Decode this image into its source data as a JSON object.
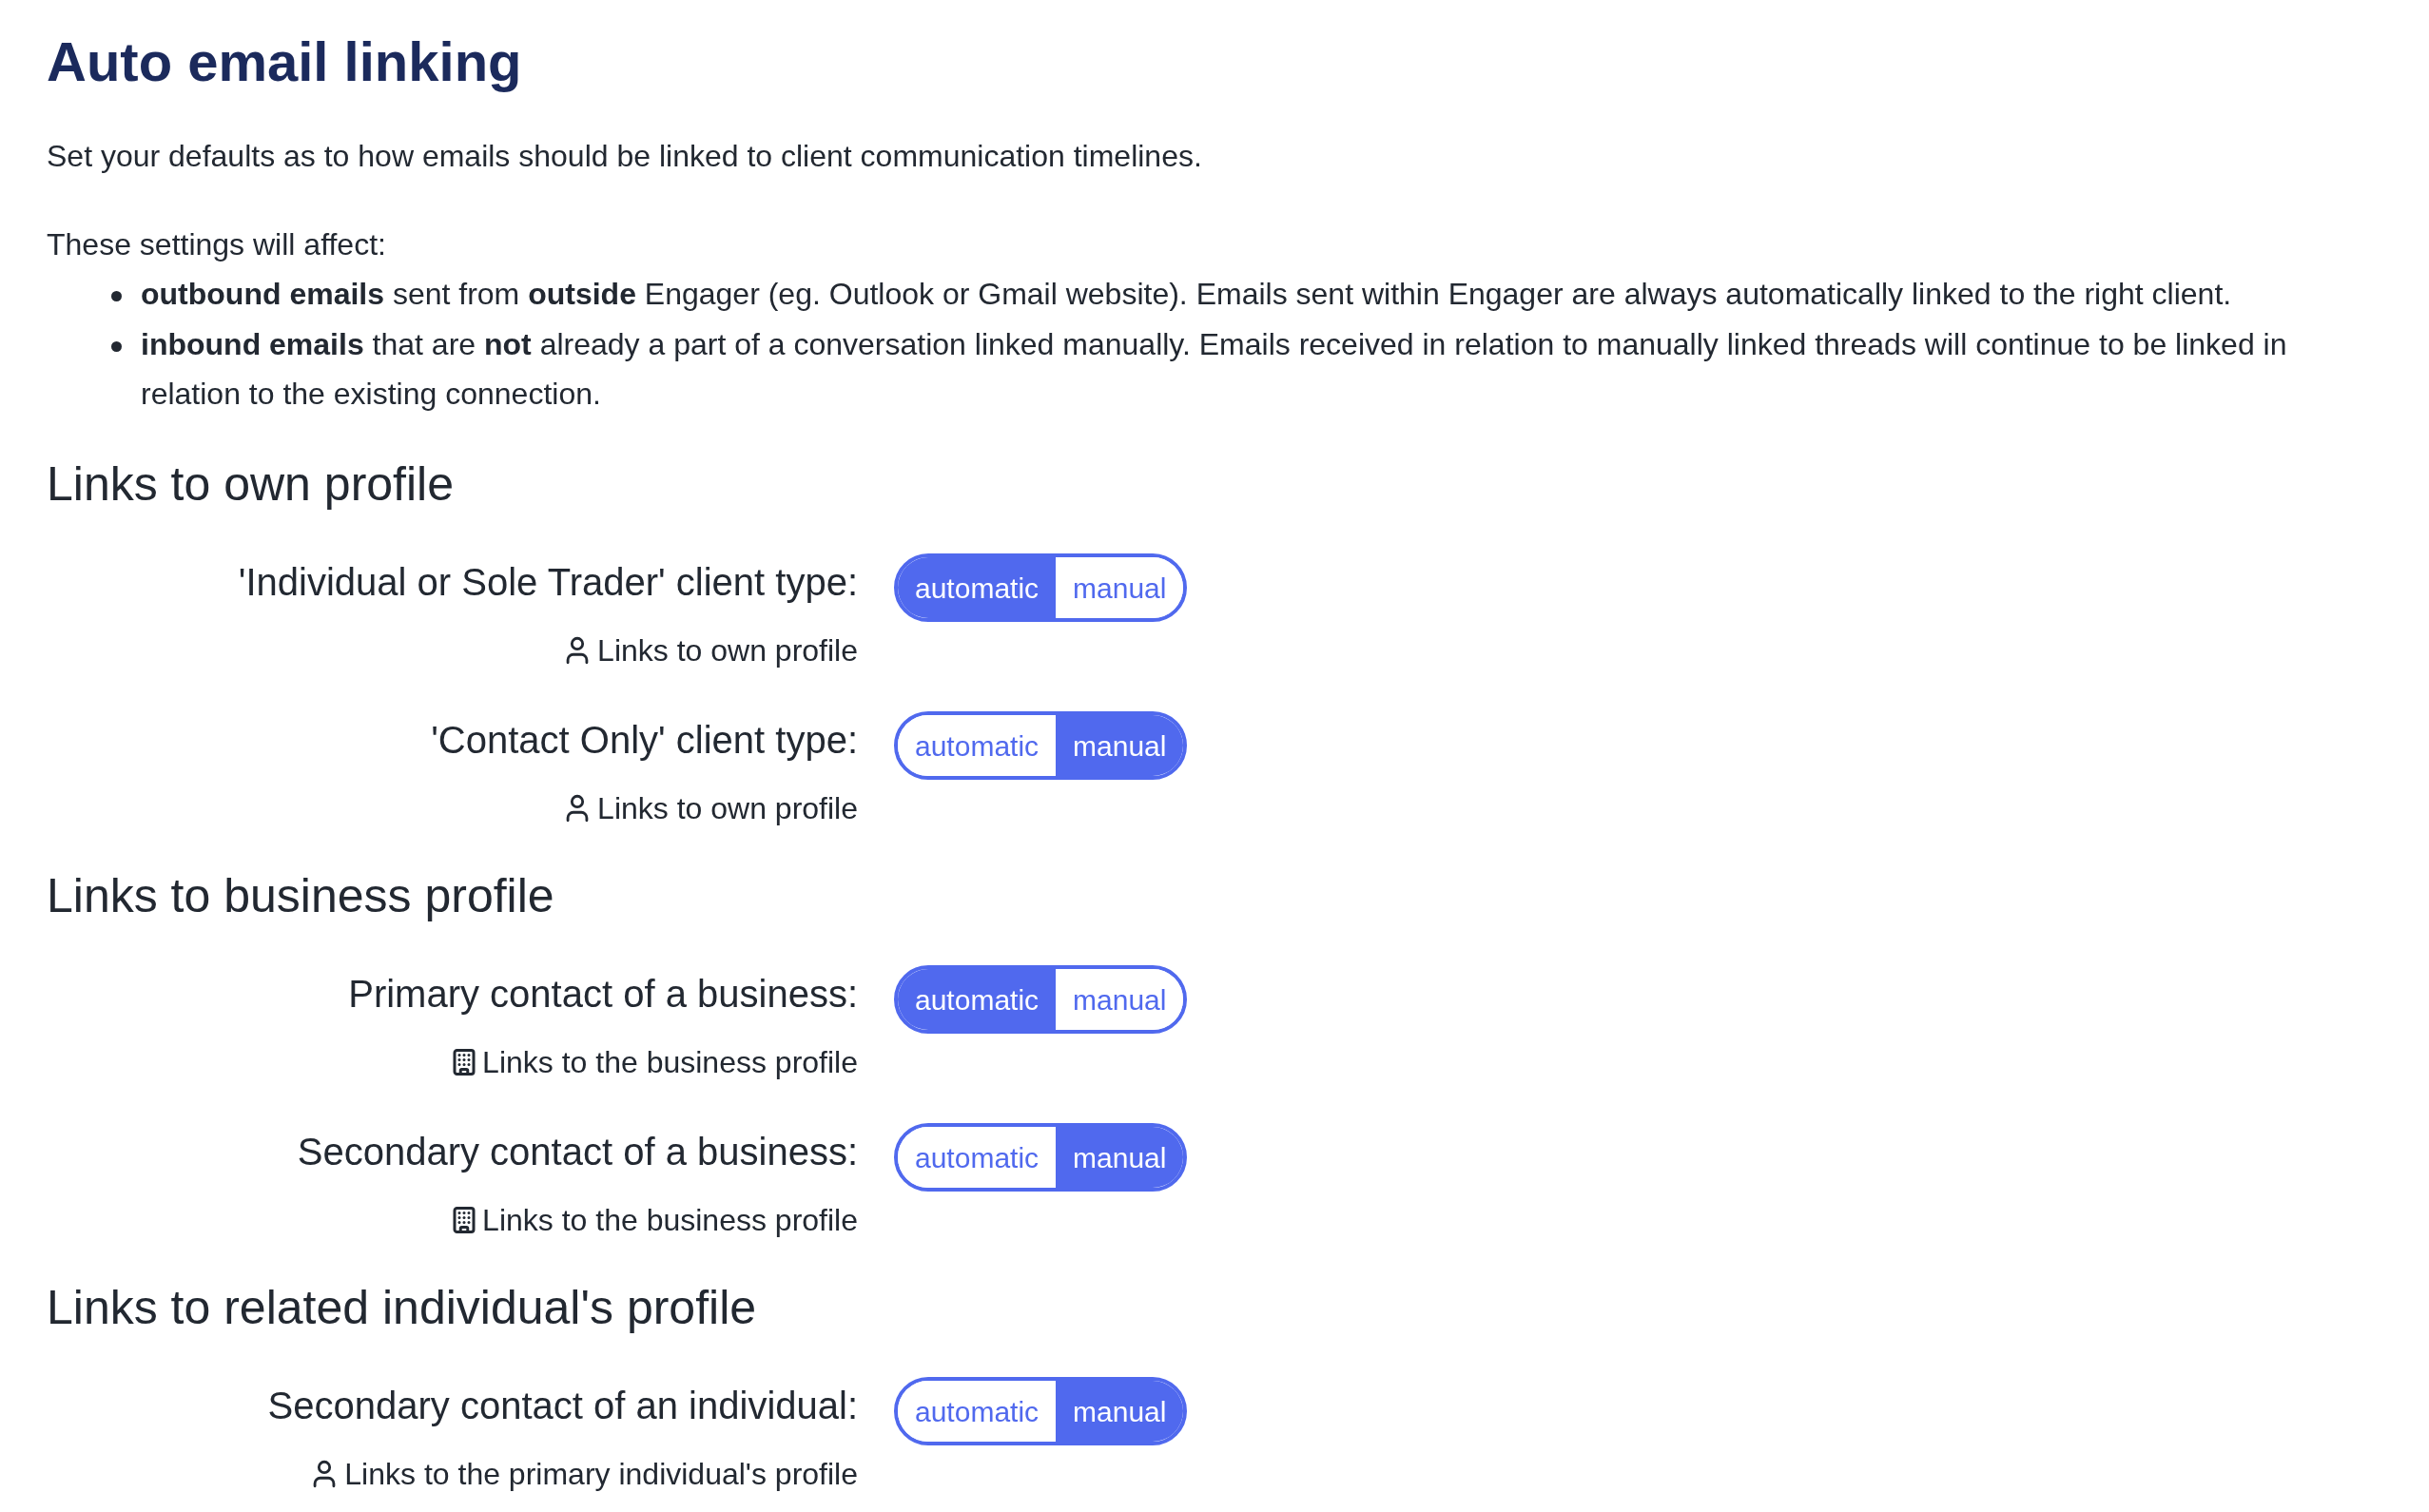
{
  "title": "Auto email linking",
  "intro": "Set your defaults as to how emails should be linked to client communication timelines.",
  "affect_heading": "These settings will affect:",
  "bullets": [
    "**outbound emails** sent from **outside** Engager (eg. Outlook or Gmail website). Emails sent within Engager are always automatically linked to the right client.",
    "**inbound emails** that are **not** already a part of a conversation linked manually. Emails received in relation to manually linked threads will continue to be linked in relation to the existing connection."
  ],
  "sections": [
    {
      "heading": "Links to own profile",
      "rows": [
        {
          "label": "'Individual or Sole Trader' client type:",
          "note": {
            "kind": "person",
            "text": "Links to own profile"
          },
          "options": [
            {
              "label": "automatic",
              "selected": true
            },
            {
              "label": "manual",
              "selected": false
            }
          ]
        },
        {
          "label": "'Contact Only' client type:",
          "note": {
            "kind": "person",
            "text": "Links to own profile"
          },
          "options": [
            {
              "label": "automatic",
              "selected": false
            },
            {
              "label": "manual",
              "selected": true
            }
          ]
        }
      ]
    },
    {
      "heading": "Links to business profile",
      "rows": [
        {
          "label": "Primary contact of a business:",
          "note": {
            "kind": "building",
            "text": "Links to the business profile"
          },
          "options": [
            {
              "label": "automatic",
              "selected": true
            },
            {
              "label": "manual",
              "selected": false
            }
          ]
        },
        {
          "label": "Secondary contact of a business:",
          "note": {
            "kind": "building",
            "text": "Links to the business profile"
          },
          "options": [
            {
              "label": "automatic",
              "selected": false
            },
            {
              "label": "manual",
              "selected": true
            }
          ]
        }
      ]
    },
    {
      "heading": "Links to related individual's profile",
      "rows": [
        {
          "label": "Secondary contact of an individual:",
          "note": {
            "kind": "person",
            "text": "Links to the primary individual's profile"
          },
          "options": [
            {
              "label": "automatic",
              "selected": false
            },
            {
              "label": "manual",
              "selected": true
            }
          ]
        }
      ]
    }
  ]
}
